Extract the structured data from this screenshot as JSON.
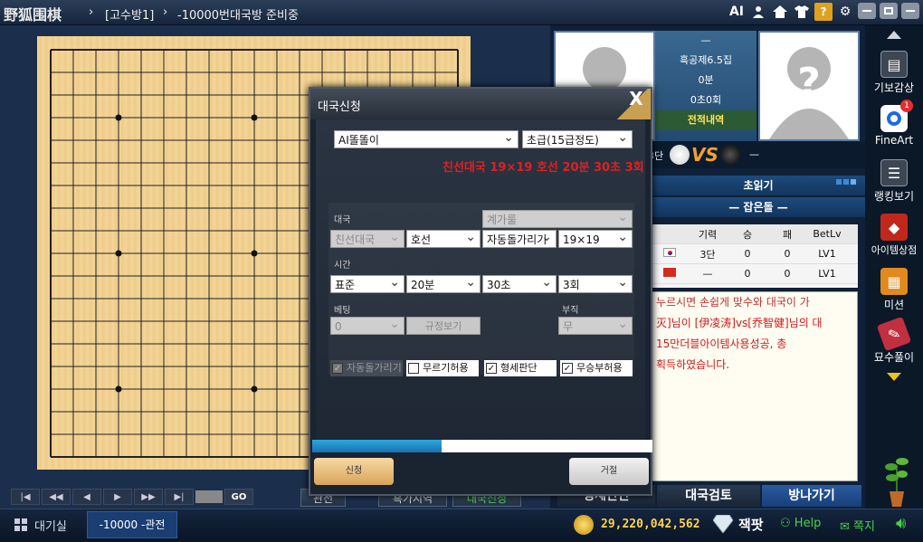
{
  "header": {
    "logo_text": "野狐围棋",
    "breadcrumb_1": "[고수방1]",
    "breadcrumb_2": "-10000번대국방 준비중",
    "ai_label": "AI",
    "help_label": "?"
  },
  "board": {
    "controls": [
      "|◀",
      "◀◀",
      "◀",
      "▶",
      "▶▶",
      "▶|"
    ],
    "go_label": "GO",
    "low_buttons": [
      "관전",
      "흑가지역",
      "대국신청"
    ]
  },
  "players": {
    "info": [
      "—",
      "흑공제6.5집",
      "0분",
      "0초0회"
    ],
    "history_label": "전적내역",
    "rank_left": "3단",
    "vs": "VS",
    "right_rank": "—"
  },
  "panel": {
    "tab1": "초읽기",
    "tab2": "— 잡은돌 —",
    "table_headers": [
      "기력",
      "승",
      "패",
      "BetLv"
    ],
    "rows": [
      {
        "flag": "kr",
        "rank": "3단",
        "win": "0",
        "loss": "0",
        "lv": "LV1"
      },
      {
        "flag": "cn",
        "rank": "—",
        "win": "0",
        "loss": "0",
        "lv": "LV1"
      }
    ],
    "chat": [
      "누르시면 손쉽게 맞수와 대국이 가",
      "",
      "",
      "灭]님이 [伊凌涛]vs[乔智健]님의 대",
      "15만더블아이템사용성공, 총",
      "획득하였습니다."
    ],
    "bottom_tabs": [
      "형세판단",
      "대국검토",
      "방나가기"
    ]
  },
  "sidebar": {
    "items": [
      "기보감상",
      "FineArt",
      "랭킹보기",
      "아이템상점",
      "미션",
      "묘수풀이"
    ],
    "badge": "1"
  },
  "statusbar": {
    "lobby": "대기실",
    "tab": "-10000 -관전",
    "coins": "29,220,042,562",
    "jackpot": "잭팟",
    "help": "Help",
    "mail": "쪽지"
  },
  "dialog": {
    "title": "대국신청",
    "close": "X",
    "opponent": "AI똘똘이",
    "level": "초급(15급정도)",
    "banner": "친선대국  19×19  호선  20분  30초  3회",
    "sec_game": "대국",
    "ruleset": "계가룰",
    "game_type": "친선대국",
    "handicap": "호선",
    "auto_stone": "자동돌가리기",
    "board_size": "19×19",
    "sec_time": "시간",
    "time_mode": "표준",
    "main_time": "20분",
    "byoyomi": "30초",
    "periods": "3회",
    "sec_bet": "베팅",
    "bet_value": "0",
    "rules_btn": "규정보기",
    "sec_bujik": "부직",
    "bujik_value": "무",
    "chk_auto": "자동돌가리기",
    "chk_undo": "무르기허용",
    "chk_judge": "형세판단",
    "chk_nowin": "무승부허용",
    "progress": 0.38,
    "apply": "신청",
    "reject": "거절"
  }
}
